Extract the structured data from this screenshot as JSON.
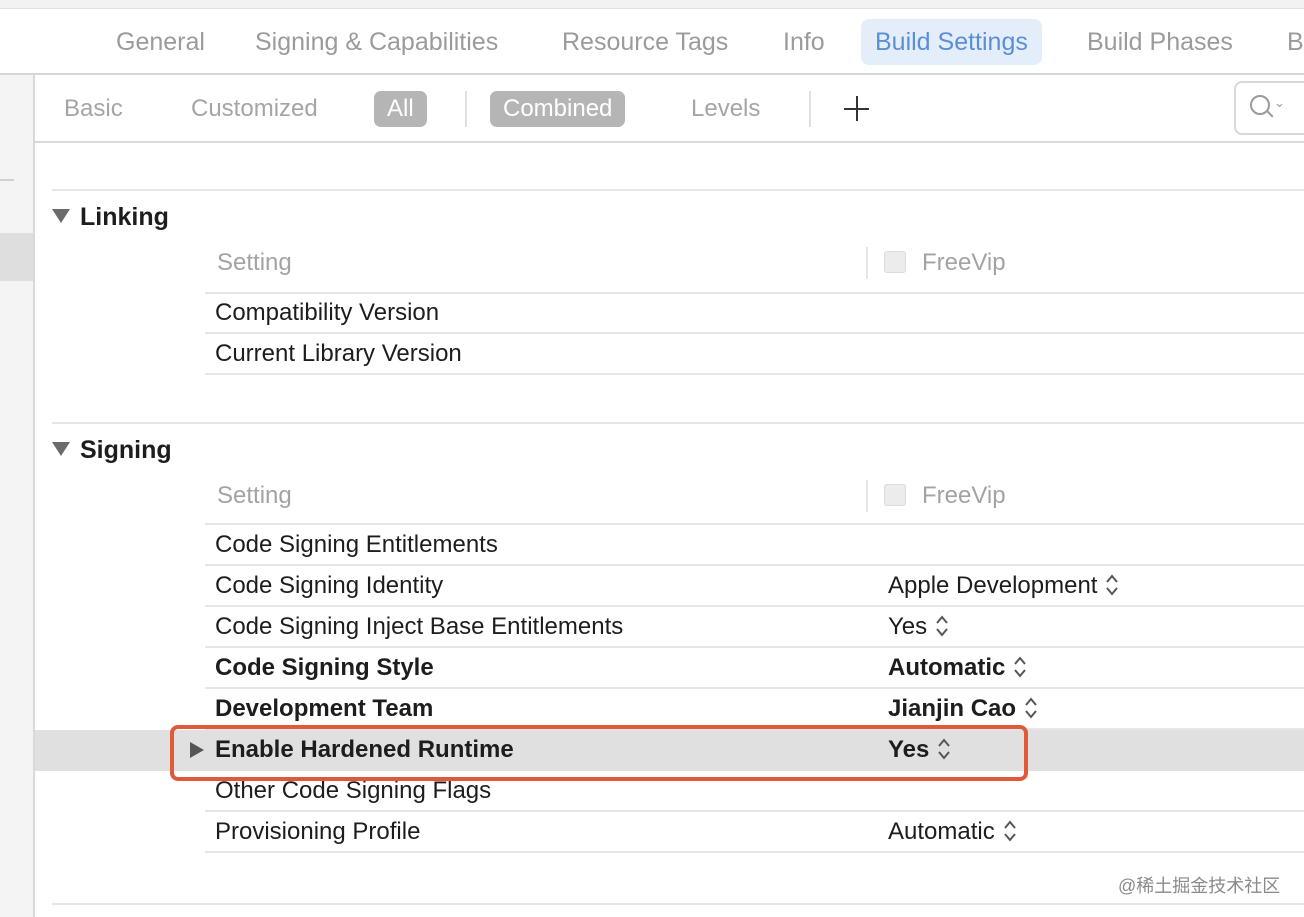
{
  "tabs": [
    "General",
    "Signing & Capabilities",
    "Resource Tags",
    "Info",
    "Build Settings",
    "Build Phases",
    "B"
  ],
  "active_tab": "Build Settings",
  "filter": {
    "basic": "Basic",
    "customized": "Customized",
    "all": "All",
    "combined": "Combined",
    "levels": "Levels",
    "search_icon": "search-icon"
  },
  "linking": {
    "title": "Linking",
    "col_setting": "Setting",
    "col_target": "FreeVip",
    "rows": [
      {
        "name": "Compatibility Version",
        "value": ""
      },
      {
        "name": "Current Library Version",
        "value": ""
      }
    ]
  },
  "signing": {
    "title": "Signing",
    "col_setting": "Setting",
    "col_target": "FreeVip",
    "rows": [
      {
        "name": "Code Signing Entitlements",
        "value": ""
      },
      {
        "name": "Code Signing Identity",
        "value": "Apple Development"
      },
      {
        "name": "Code Signing Inject Base Entitlements",
        "value": "Yes"
      },
      {
        "name": "Code Signing Style",
        "value": "Automatic"
      },
      {
        "name": "Development Team",
        "value": "Jianjin Cao"
      },
      {
        "name": "Enable Hardened Runtime",
        "value": "Yes"
      },
      {
        "name": "Other Code Signing Flags",
        "value": ""
      },
      {
        "name": "Provisioning Profile",
        "value": "Automatic"
      }
    ]
  },
  "highlight_color": "#e05a3a",
  "watermark": "@稀土掘金技术社区"
}
